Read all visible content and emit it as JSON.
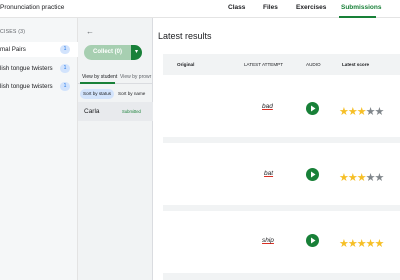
{
  "header": {
    "app_title": "Pronunciation practice",
    "nav": [
      {
        "label": "Class"
      },
      {
        "label": "Files"
      },
      {
        "label": "Exercises"
      },
      {
        "label": "Submissions",
        "active": true
      }
    ]
  },
  "sidebar": {
    "section_label": "CISES (3)",
    "items": [
      {
        "label": "mal Pairs",
        "count": "1",
        "selected": true
      },
      {
        "label": "lish tongue twisters",
        "count": "1"
      },
      {
        "label": "lish tongue twisters",
        "count": "1"
      }
    ]
  },
  "middle": {
    "collect_label": "Collect (0)",
    "view_tabs": [
      {
        "label": "View by student",
        "active": true
      },
      {
        "label": "View by prowr"
      }
    ],
    "sort_chips": [
      {
        "label": "Sort by status",
        "active": true
      },
      {
        "label": "Sort by name"
      }
    ],
    "student": {
      "name": "Carla",
      "status": "Submitted"
    }
  },
  "results": {
    "title": "Latest results",
    "columns": {
      "original": "Original",
      "latest_attempt": "LATEST ATTEMPT",
      "audio": "AUDIO",
      "latest_score": "Latest score"
    },
    "rows": [
      {
        "word": "bad",
        "score": 3,
        "max": 5
      },
      {
        "word": "bat",
        "score": 3,
        "max": 5
      },
      {
        "word": "ship",
        "score": 5,
        "max": 5
      }
    ]
  },
  "colors": {
    "accent": "#188038",
    "star": "#f6bf26",
    "star_empty": "#80868b",
    "chip": "#d2e3fc"
  }
}
